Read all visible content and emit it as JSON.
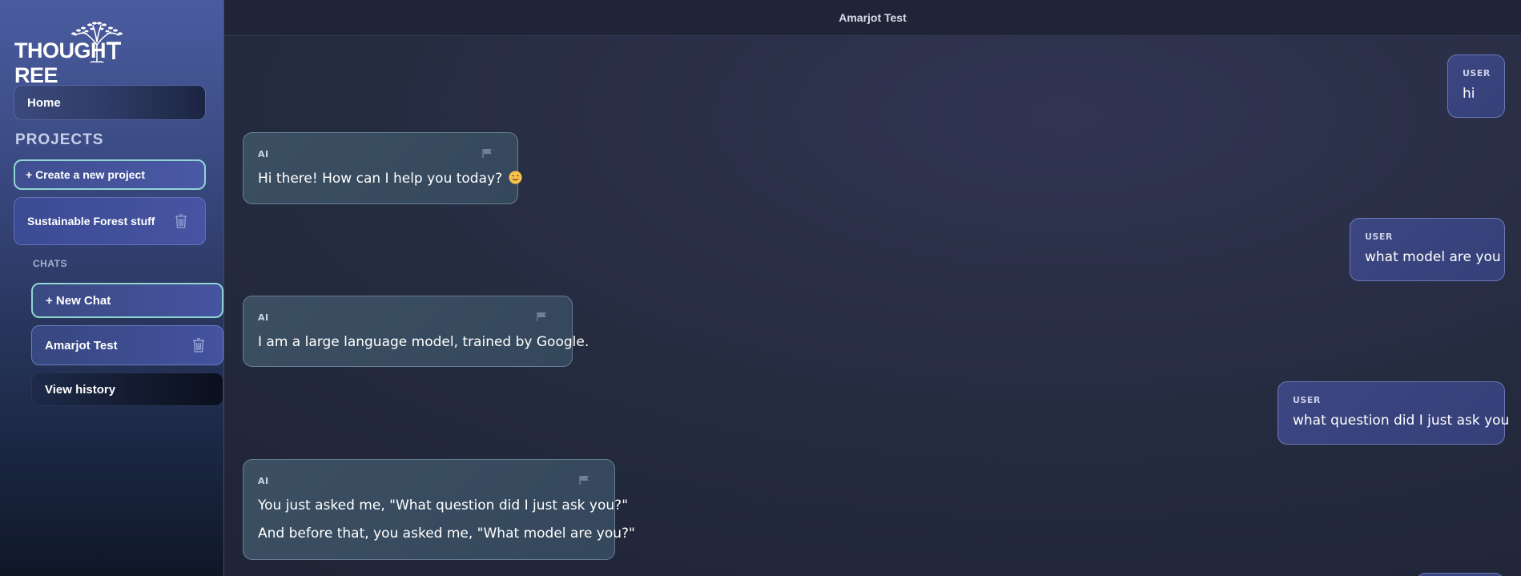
{
  "app": {
    "brand_name": "THOUGHTREE",
    "brand_left": "THOUGH",
    "brand_right": "REE"
  },
  "sidebar": {
    "home_label": "Home",
    "projects_heading": "PROJECTS",
    "create_project_label": "+ Create a new project",
    "projects": [
      {
        "name": "Sustainable Forest stuff"
      }
    ],
    "chats_heading": "CHATS",
    "new_chat_label": "+ New Chat",
    "chats": [
      {
        "name": "Amarjot Test"
      }
    ],
    "view_history_label": "View history"
  },
  "chat": {
    "title": "Amarjot Test",
    "messages": [
      {
        "role": "USER",
        "lines": [
          "hi"
        ]
      },
      {
        "role": "AI",
        "lines": [
          "Hi there! How can I help you today?"
        ],
        "emoji": "smiling-face-icon"
      },
      {
        "role": "USER",
        "lines": [
          "what model are you"
        ]
      },
      {
        "role": "AI",
        "lines": [
          "I am a large language model, trained by Google."
        ]
      },
      {
        "role": "USER",
        "lines": [
          "what question did I just ask you"
        ]
      },
      {
        "role": "AI",
        "lines": [
          "You just asked me, \"What question did I just ask you?\"",
          "And before that, you asked me, \"What model are you?\""
        ]
      }
    ]
  },
  "icons": {
    "trash": "trash-icon",
    "flag": "flag-icon",
    "logo": "tree-logo-icon"
  },
  "colors": {
    "accent_border": "#8fd6d2",
    "user_bubble": "#3c4681",
    "ai_bubble": "#3c4f62"
  }
}
